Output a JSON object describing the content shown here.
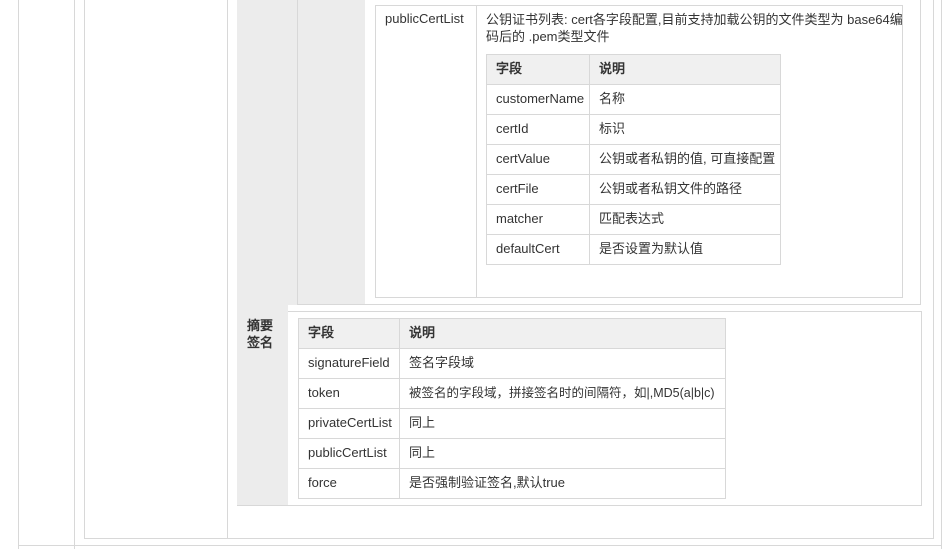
{
  "public_cert": {
    "field_name": "publicCertList",
    "description_line1": "公钥证书列表: cert各字段配置,目前支持加载公钥的文件类型为 base64编",
    "description_line2": "码后的 .pem类型文件",
    "table": {
      "headers": [
        "字段",
        "说明"
      ],
      "rows": [
        [
          "customerName",
          "名称"
        ],
        [
          "certId",
          "标识"
        ],
        [
          "certValue",
          "公钥或者私钥的值, 可直接配置"
        ],
        [
          "certFile",
          "公钥或者私钥文件的路径"
        ],
        [
          "matcher",
          "匹配表达式"
        ],
        [
          "defaultCert",
          "是否设置为默认值"
        ]
      ]
    }
  },
  "signature": {
    "label_line1": "摘要",
    "label_line2": "签名",
    "table": {
      "headers": [
        "字段",
        "说明"
      ],
      "rows": [
        [
          "signatureField",
          "签名字段域"
        ],
        [
          "token",
          "被签名的字段域，拼接签名时的间隔符，如|,MD5(a|b|c)"
        ],
        [
          "privateCertList",
          "同上"
        ],
        [
          "publicCertList",
          "同上"
        ],
        [
          "force",
          "是否强制验证签名,默认true"
        ]
      ]
    }
  },
  "colors": {
    "gray_band": "#ececec",
    "header_bg": "#f0f0f0",
    "border": "#d8d8d8",
    "text": "#333333"
  }
}
